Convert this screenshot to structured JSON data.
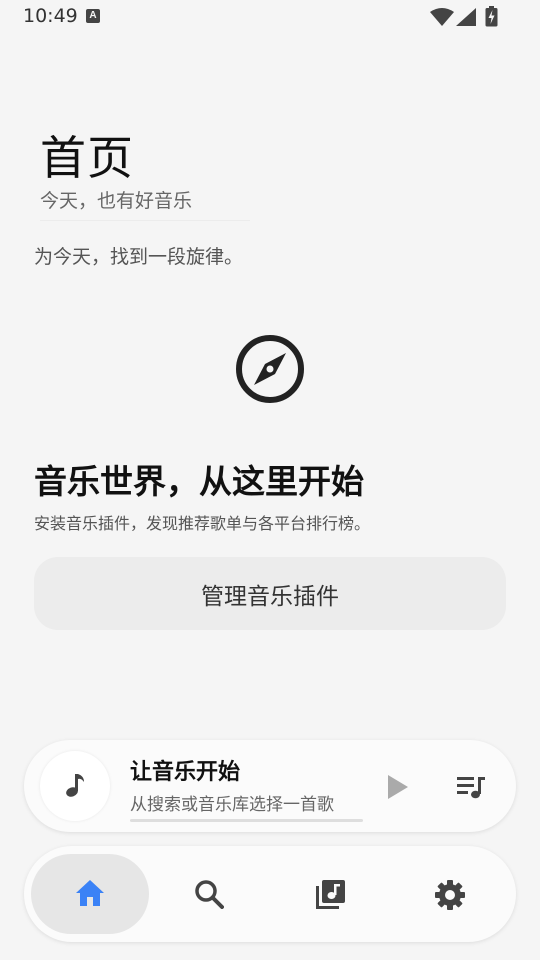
{
  "status_bar": {
    "time": "10:49",
    "ime_icon": "keyboard-a-icon"
  },
  "header": {
    "title": "首页",
    "subtitle": "今天，也有好音乐"
  },
  "tagline": "为今天，找到一段旋律。",
  "hero": {
    "icon": "compass-icon",
    "title": "音乐世界，从这里开始",
    "description": "安装音乐插件，发现推荐歌单与各平台排行榜。",
    "button_label": "管理音乐插件"
  },
  "player": {
    "title": "让音乐开始",
    "subtitle": "从搜索或音乐库选择一首歌",
    "progress": 0
  },
  "nav": {
    "items": [
      {
        "name": "home",
        "icon": "home-icon",
        "active": true
      },
      {
        "name": "search",
        "icon": "search-icon",
        "active": false
      },
      {
        "name": "library",
        "icon": "music-library-icon",
        "active": false
      },
      {
        "name": "settings",
        "icon": "gear-icon",
        "active": false
      }
    ]
  },
  "colors": {
    "accent": "#3b82f6",
    "icon": "#444444",
    "background": "#f5f5f5"
  }
}
